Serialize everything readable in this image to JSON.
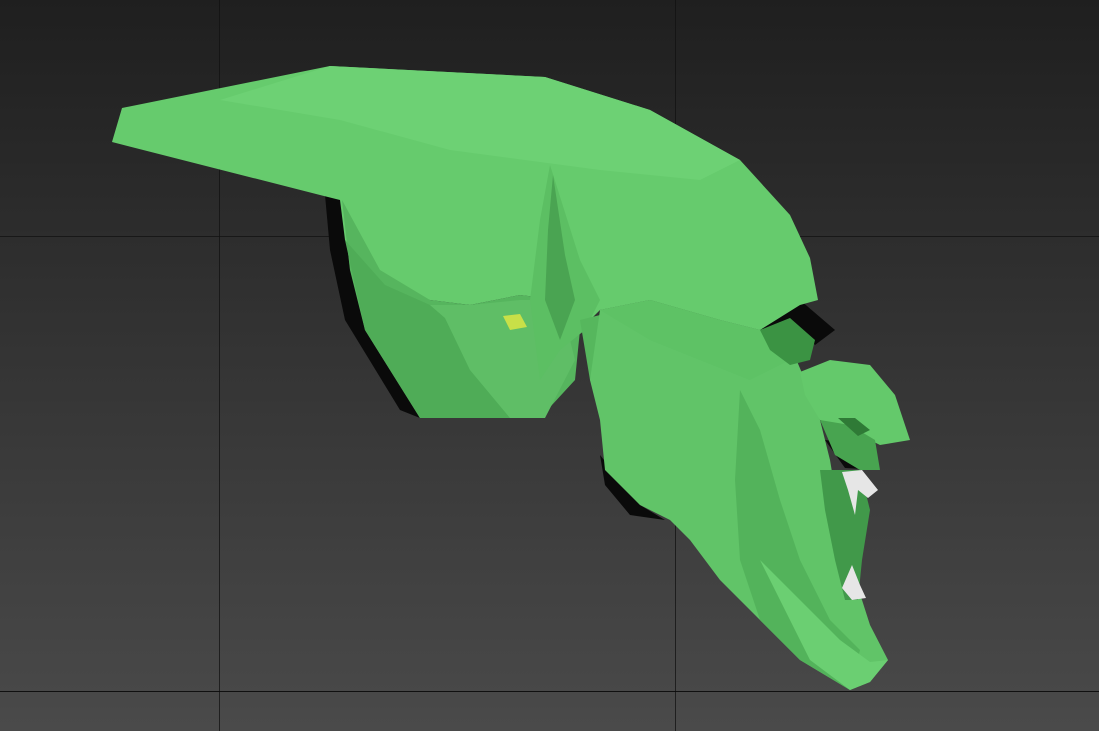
{
  "viewport": {
    "background_top": "#1f1f1f",
    "background_bottom": "#4a4a4a",
    "grid_color": "#121212"
  },
  "model": {
    "base_color": "#63c86a",
    "light_color": "#6fd174",
    "shadow_color": "#3e9a47",
    "edge_shadow_color": "#050505",
    "tooth_color": "#e6e6e6",
    "highlight_color": "#c8e048"
  }
}
